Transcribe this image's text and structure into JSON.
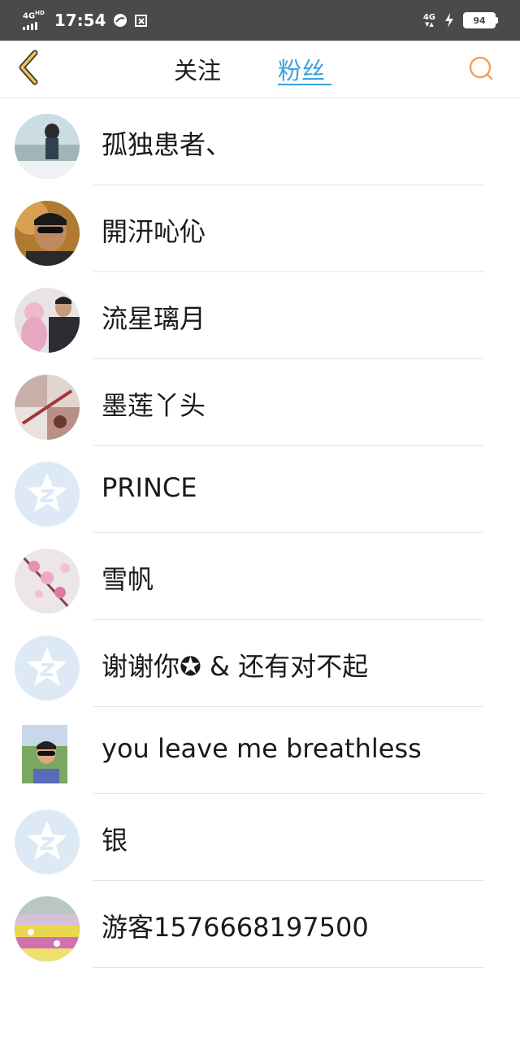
{
  "status_bar": {
    "network": "4G",
    "network_sup": "HD",
    "time": "17:54",
    "network_right": "4G",
    "battery": "94"
  },
  "header": {
    "tabs": [
      {
        "label": "关注",
        "active": false
      },
      {
        "label": "粉丝",
        "active": true
      }
    ],
    "accent_color": "#3aa0e0",
    "back_icon": "chevron-left-icon",
    "search_icon": "search-icon"
  },
  "fans": [
    {
      "name": "孤独患者、",
      "avatar": "photo-woman-outdoor"
    },
    {
      "name": "開汧吣伈",
      "avatar": "photo-man-sunglasses"
    },
    {
      "name": "流星璃月",
      "avatar": "photo-man-with-baby"
    },
    {
      "name": "墨莲丫头",
      "avatar": "photo-collage"
    },
    {
      "name": "PRINCE",
      "avatar": "default-qq-avatar"
    },
    {
      "name": "雪帆",
      "avatar": "photo-pink-blossom"
    },
    {
      "name": "谢谢你✪ & 还有对不起",
      "avatar": "default-qq-avatar"
    },
    {
      "name": "you leave me breathless",
      "avatar": "photo-boy-sunglasses"
    },
    {
      "name": "银",
      "avatar": "default-qq-avatar"
    },
    {
      "name": "游客1576668197500",
      "avatar": "photo-flower-field"
    }
  ]
}
